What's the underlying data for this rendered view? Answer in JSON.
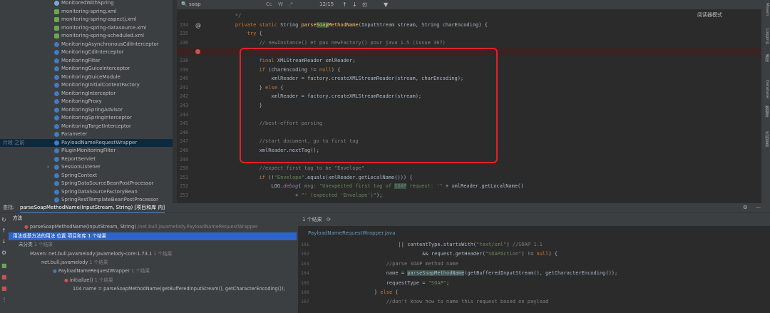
{
  "project_tree": [
    {
      "label": "MonitoredWithSpring",
      "icon": "interface"
    },
    {
      "label": "monitoring-spring.xml",
      "icon": "xml"
    },
    {
      "label": "monitoring-spring-aspectj.xml",
      "icon": "xml"
    },
    {
      "label": "monitoring-spring-datasource.xml",
      "icon": "xml"
    },
    {
      "label": "monitoring-spring-scheduled.xml",
      "icon": "xml"
    },
    {
      "label": "MonitoringAsynchronousCdiInterceptor",
      "icon": "class"
    },
    {
      "label": "MonitoringCdiInterceptor",
      "icon": "class"
    },
    {
      "label": "MonitoringFilter",
      "icon": "class"
    },
    {
      "label": "MonitoringGuiceInterceptor",
      "icon": "class"
    },
    {
      "label": "MonitoringGuiceModule",
      "icon": "class"
    },
    {
      "label": "MonitoringInitialContextFactory",
      "icon": "class"
    },
    {
      "label": "MonitoringInterceptor",
      "icon": "class"
    },
    {
      "label": "MonitoringProxy",
      "icon": "class"
    },
    {
      "label": "MonitoringSpringAdvisor",
      "icon": "class"
    },
    {
      "label": "MonitoringSpringInterceptor",
      "icon": "class"
    },
    {
      "label": "MonitoringTargetInterceptor",
      "icon": "class"
    },
    {
      "label": "Parameter",
      "icon": "class"
    },
    {
      "label": "PayloadNameRequestWrapper",
      "icon": "class",
      "hint": "片段 之前",
      "selected": true
    },
    {
      "label": "PluginMonitoringFilter",
      "icon": "class"
    },
    {
      "label": "ReportServlet",
      "icon": "class"
    },
    {
      "label": "SessionListener",
      "icon": "class",
      "expandable": true
    },
    {
      "label": "SpringContext",
      "icon": "class"
    },
    {
      "label": "SpringDataSourceBeanPostProcessor",
      "icon": "class"
    },
    {
      "label": "SpringDataSourceFactoryBean",
      "icon": "class"
    },
    {
      "label": "SpringRestTemplateBeanPostProcessor",
      "icon": "class"
    }
  ],
  "findbar": {
    "query": "soap",
    "opts": [
      "Cc",
      "W",
      ".*"
    ],
    "count": "12/15"
  },
  "reader_mode": "阅读器模式",
  "editor_lines": [
    {
      "n": "",
      "html": "    <span class=\"cm\">*/</span>"
    },
    {
      "n": "234",
      "html": "    <span class=\"kw\">private static</span> String <span class=\"fn\">parse<span class=\"hl\">Soap</span>MethodName</span>(InputStream stream, String charEncoding) {"
    },
    {
      "n": "235",
      "html": "        <span class=\"kw\">try</span> {"
    },
    {
      "n": "236",
      "html": "            <span class=\"cm\">// newInstance() et pas newFactory() pour java 1.5 (issue 367)</span>"
    },
    {
      "n": "237",
      "html": "            <span class=\"kw\">final</span> XMLInputFactory factory = XMLInputFactory.<span class=\"it\">newInstance</span>();"
    },
    {
      "n": "238",
      "html": "            <span class=\"kw\">final</span> XMLStreamReader xmlReader;"
    },
    {
      "n": "239",
      "html": "            <span class=\"kw\">if</span> (charEncoding != <span class=\"kw\">null</span>) {"
    },
    {
      "n": "240",
      "html": "                xmlReader = factory.createXMLStreamReader(stream, charEncoding);"
    },
    {
      "n": "241",
      "html": "            } <span class=\"kw\">else</span> {"
    },
    {
      "n": "242",
      "html": "                xmlReader = factory.createXMLStreamReader(stream);"
    },
    {
      "n": "243",
      "html": "            }"
    },
    {
      "n": "244",
      "html": ""
    },
    {
      "n": "245",
      "html": "            <span class=\"cm\">//best-effort parsing</span>"
    },
    {
      "n": "246",
      "html": ""
    },
    {
      "n": "247",
      "html": "            <span class=\"cm\">//start document, go to first tag</span>"
    },
    {
      "n": "248",
      "html": "            xmlReader.nextTag();"
    },
    {
      "n": "249",
      "html": ""
    },
    {
      "n": "250",
      "html": "            <span class=\"cm\">//expect first tag to be \"Envelope\"</span>"
    },
    {
      "n": "251",
      "html": "            <span class=\"kw\">if</span> (!<span class=\"str\">\"Envelope\"</span>.equals(xmlReader.getLocalName())) {"
    },
    {
      "n": "252",
      "html": "                LOG.<span class=\"it\">debug</span>( <span class=\"cm\">msg:</span> <span class=\"str\">\"Unexpected first tag of <span class=\"hl2\">SOAP</span> request: '\"</span> + xmlReader.getLocalName()"
    },
    {
      "n": "253",
      "html": "                        + <span class=\"str\">\"' (expected 'Envelope')\"</span>);"
    }
  ],
  "right_tabs": [
    "Maven",
    "Logging",
    "通知",
    "Database",
    "数据库",
    "代码审查"
  ],
  "find_panel": {
    "label": "查找:",
    "tab": "parseSoapMethodName(InputStream, String) [项目和库 内]",
    "results": [
      {
        "text": "方法",
        "indent": 6,
        "bold": true
      },
      {
        "text": "parseSoapMethodName(InputStream, String)",
        "gray": " /net.bull.javamelody.PayloadNameRequestWrapper",
        "indent": 22,
        "icon": "method"
      },
      {
        "text": "用法或基方法的用法 位置 项目和库  1 个结果",
        "indent": 6,
        "selected": true
      },
      {
        "text": "未分类",
        "gray": "  1 个结果",
        "indent": 14
      },
      {
        "text": "Maven: net.bull.javamelody:javamelody-core:1.73.1",
        "gray": "  1 个结果",
        "indent": 30
      },
      {
        "text": "net.bull.javamelody",
        "gray": "  1 个结果",
        "indent": 46
      },
      {
        "text": "PayloadNameRequestWrapper",
        "gray": "  1 个结果",
        "indent": 62,
        "icon": "class"
      },
      {
        "text": "initialize()",
        "gray": "  1 个结果",
        "indent": 78,
        "icon": "method"
      },
      {
        "text": "104 name = parseSoapMethodName(getBufferedInputStream(), getCharacterEncoding());",
        "indent": 90
      }
    ],
    "preview_head": "1 个结果",
    "preview_file": "PayloadNameRequestWrapper.java",
    "preview_lines": [
      {
        "n": "101",
        "html": "            || contentType.startsWith(<span class=\"str\">\"text/xml\"</span>) <span class=\"cm\">//SOAP 1.1</span>"
      },
      {
        "n": "102",
        "html": "                    && request.getHeader(<span class=\"str\">\"SOAPAction\"</span>) != <span class=\"kw\">null</span>) {"
      },
      {
        "n": "103",
        "html": "        <span class=\"cm\">//parse SOAP method name</span>"
      },
      {
        "n": "104",
        "html": "        name = <span class=\"hl2\">parseSoapMethodName</span>(getBufferedInputStream(), getCharacterEncoding());"
      },
      {
        "n": "105",
        "html": "        requestType = <span class=\"str\">\"SOAP\"</span>;"
      },
      {
        "n": "106",
        "html": "    } <span class=\"kw\">else</span> {"
      },
      {
        "n": "107",
        "html": "        <span class=\"cm\">//don't know how to name this request based on payload</span>"
      }
    ]
  }
}
